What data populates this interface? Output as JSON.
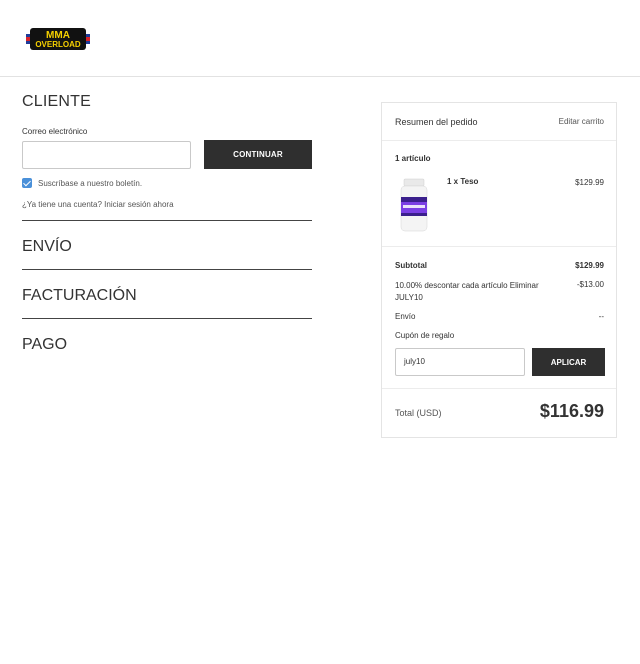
{
  "brand": {
    "logo_text": "MMA OVERLOAD"
  },
  "customer": {
    "title": "CLIENTE",
    "email_label": "Correo electrónico",
    "email_value": "",
    "continue_label": "CONTINUAR",
    "newsletter_label": "Suscríbase a nuestro boletín.",
    "newsletter_checked": true,
    "login_prompt": "¿Ya tiene una cuenta?",
    "login_link": "Iniciar sesión ahora"
  },
  "steps": [
    {
      "label": "ENVÍO"
    },
    {
      "label": "FACTURACIÓN"
    },
    {
      "label": "PAGO"
    }
  ],
  "summary": {
    "title": "Resumen del pedido",
    "edit_cart": "Editar carrito",
    "item_count": "1 artículo",
    "product": {
      "name": "1 x Teso",
      "price": "$129.99"
    },
    "subtotal_label": "Subtotal",
    "subtotal_value": "$129.99",
    "discount_label": "10.00% descontar cada artículo Eliminar JULY10",
    "discount_value": "-$13.00",
    "shipping_label": "Envío",
    "shipping_value": "--",
    "coupon_label": "Cupón de regalo",
    "coupon_value": "july10",
    "apply_label": "APLICAR",
    "total_label": "Total (USD)",
    "total_value": "$116.99"
  },
  "colors": {
    "button_bg": "#2f2f2f",
    "checkbox": "#4a90d9",
    "logo_yellow": "#f5d000",
    "logo_red": "#d8232a",
    "logo_blue": "#1f3c99"
  }
}
